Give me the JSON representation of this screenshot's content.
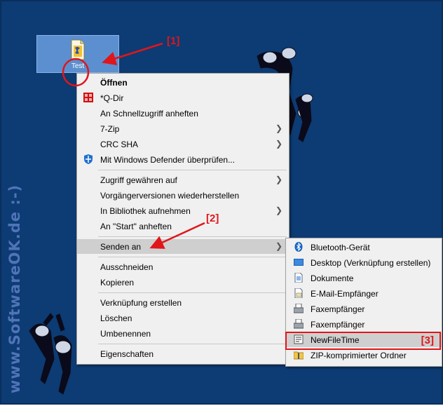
{
  "desktop": {
    "watermark": "www.SoftwareOK.de :-)",
    "file_icon_label": "Test"
  },
  "annotations": {
    "label1": "[1]",
    "label2": "[2]",
    "label3": "[3]",
    "color": "#e0161b"
  },
  "context_menu": {
    "items": [
      {
        "label": "Öffnen",
        "bold": true
      },
      {
        "label": "*Q-Dir",
        "icon": "qdir-icon"
      },
      {
        "label": "An Schnellzugriff anheften"
      },
      {
        "label": "7-Zip",
        "submenu": true
      },
      {
        "label": "CRC SHA",
        "submenu": true
      },
      {
        "label": "Mit Windows Defender überprüfen...",
        "icon": "defender-shield-icon"
      },
      {
        "label": "Zugriff gewähren auf",
        "submenu": true
      },
      {
        "label": "Vorgängerversionen wiederherstellen"
      },
      {
        "label": "In Bibliothek aufnehmen",
        "submenu": true
      },
      {
        "label": "An \"Start\" anheften"
      },
      {
        "label": "Senden an",
        "submenu": true,
        "highlighted": true
      },
      {
        "label": "Ausschneiden"
      },
      {
        "label": "Kopieren"
      },
      {
        "label": "Verknüpfung erstellen"
      },
      {
        "label": "Löschen"
      },
      {
        "label": "Umbenennen"
      },
      {
        "label": "Eigenschaften"
      }
    ]
  },
  "send_to_menu": {
    "items": [
      {
        "label": "Bluetooth-Gerät",
        "icon": "bluetooth-icon"
      },
      {
        "label": "Desktop (Verknüpfung erstellen)",
        "icon": "desktop-icon"
      },
      {
        "label": "Dokumente",
        "icon": "documents-icon"
      },
      {
        "label": "E-Mail-Empfänger",
        "icon": "mail-icon"
      },
      {
        "label": "Faxempfänger",
        "icon": "fax-icon"
      },
      {
        "label": "Faxempfänger",
        "icon": "fax-icon"
      },
      {
        "label": "NewFileTime",
        "icon": "newfiletime-icon",
        "highlighted": true
      },
      {
        "label": "ZIP-komprimierter Ordner",
        "icon": "zip-folder-icon"
      }
    ]
  }
}
